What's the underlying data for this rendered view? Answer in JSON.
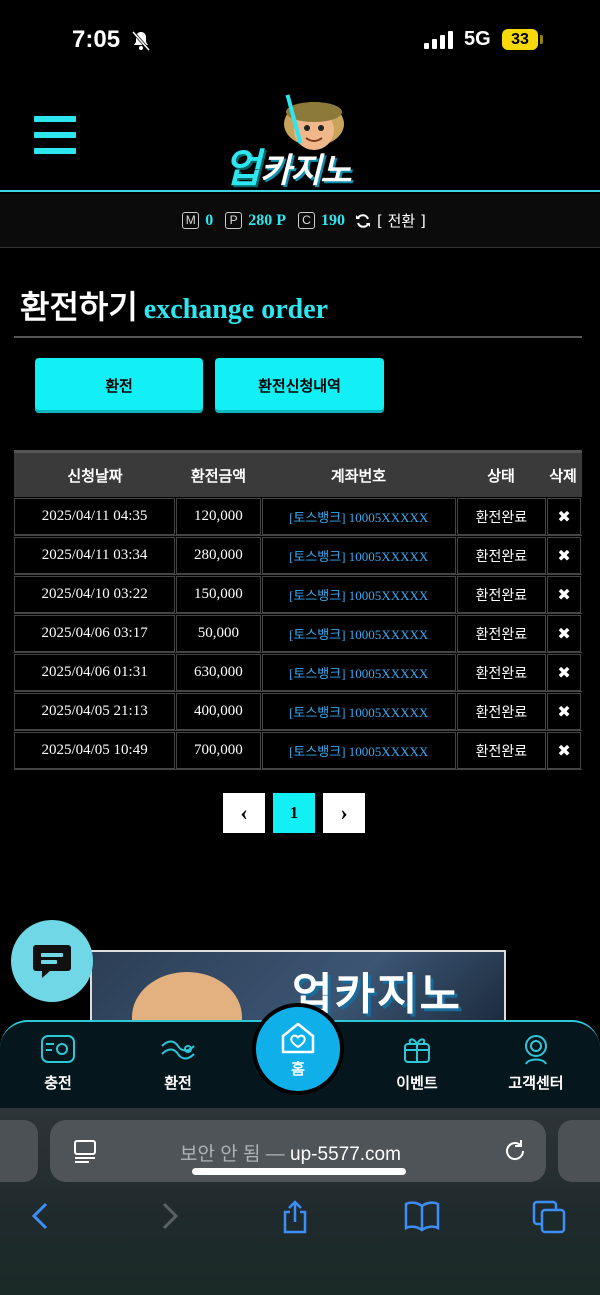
{
  "status_bar": {
    "time": "7:05",
    "network": "5G",
    "battery": "33"
  },
  "header": {
    "logo_text_big": "업",
    "logo_text": "카지노"
  },
  "balance": {
    "m_badge": "M",
    "m_value": "0",
    "p_badge": "P",
    "p_value": "280 P",
    "c_badge": "C",
    "c_value": "190",
    "switch_label": "[ 전환 ]"
  },
  "page": {
    "title": "환전하기",
    "subtitle": "exchange order"
  },
  "buttons": {
    "exchange": "환전",
    "history": "환전신청내역"
  },
  "table": {
    "headers": [
      "신청날짜",
      "환전금액",
      "계좌번호",
      "상태",
      "삭제"
    ],
    "rows": [
      {
        "date": "2025/04/11 04:35",
        "amount": "120,000",
        "account": "[토스뱅크] 10005XXXXX",
        "status": "환전완료"
      },
      {
        "date": "2025/04/11 03:34",
        "amount": "280,000",
        "account": "[토스뱅크] 10005XXXXX",
        "status": "환전완료"
      },
      {
        "date": "2025/04/10 03:22",
        "amount": "150,000",
        "account": "[토스뱅크] 10005XXXXX",
        "status": "환전완료"
      },
      {
        "date": "2025/04/06 03:17",
        "amount": "50,000",
        "account": "[토스뱅크] 10005XXXXX",
        "status": "환전완료"
      },
      {
        "date": "2025/04/06 01:31",
        "amount": "630,000",
        "account": "[토스뱅크] 10005XXXXX",
        "status": "환전완료"
      },
      {
        "date": "2025/04/05 21:13",
        "amount": "400,000",
        "account": "[토스뱅크] 10005XXXXX",
        "status": "환전완료"
      },
      {
        "date": "2025/04/05 10:49",
        "amount": "700,000",
        "account": "[토스뱅크] 10005XXXXX",
        "status": "환전완료"
      }
    ],
    "delete_glyph": "✖"
  },
  "pagination": {
    "prev": "‹",
    "current": "1",
    "next": "›"
  },
  "banner": {
    "text": "업카지노"
  },
  "bottom_nav": {
    "charge": "충전",
    "exchange": "환전",
    "home": "홈",
    "event": "이벤트",
    "support": "고객센터"
  },
  "browser": {
    "security": "보안 안 됨",
    "separator": " — ",
    "domain": "up-5577.com"
  },
  "colors": {
    "accent": "#12f0f5",
    "link": "#3aa8f0",
    "home": "#0fb0ea"
  }
}
